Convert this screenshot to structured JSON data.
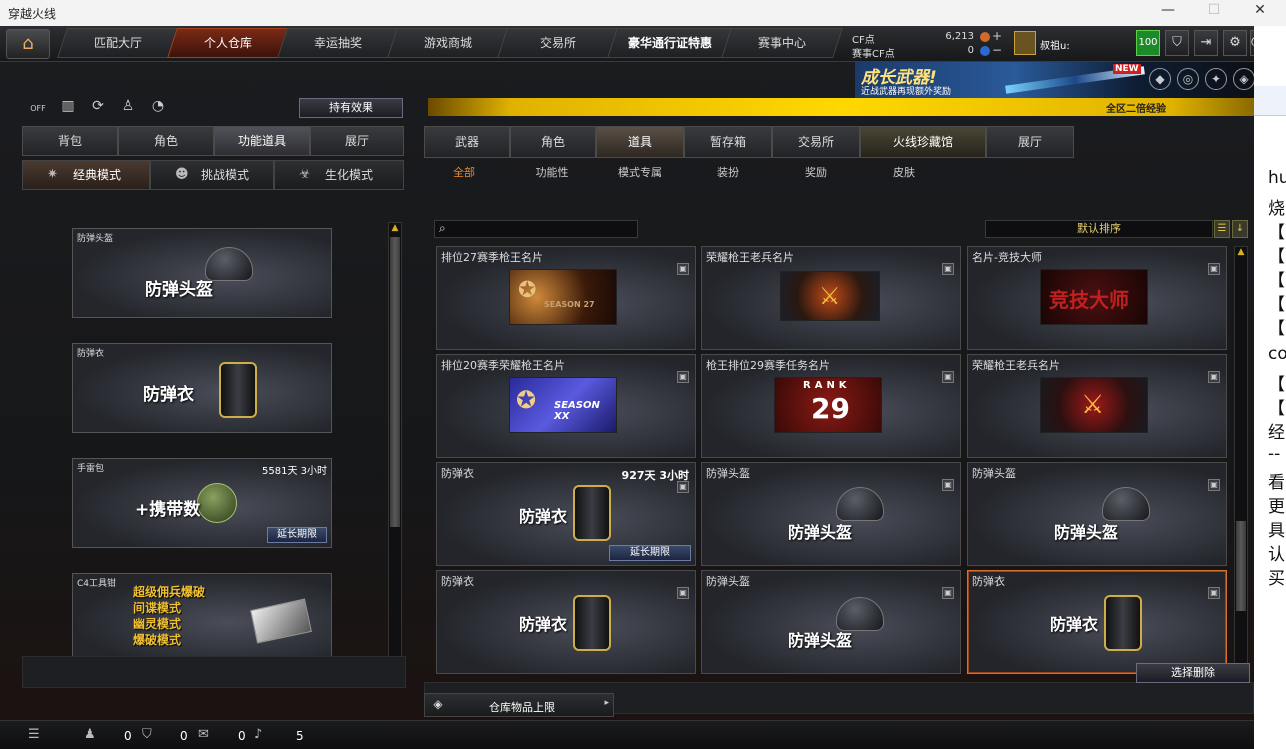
{
  "window": {
    "title": "穿越火线",
    "minimize": "—",
    "maximize": "☐",
    "close": "✕"
  },
  "nav": {
    "home_icon": "home-icon",
    "tabs": [
      "匹配大厅",
      "个人仓库",
      "幸运抽奖",
      "游戏商城",
      "交易所",
      "豪华通行证特惠",
      "赛事中心"
    ],
    "active": "个人仓库"
  },
  "currency": {
    "cf_label": "CF点",
    "cf_value": "6,213",
    "match_label": "赛事CF点",
    "match_value": "0",
    "plus": "+",
    "minus": "−"
  },
  "player": {
    "name": "叔祖u:",
    "level": "100"
  },
  "top_icons": {
    "shield": "⛉",
    "exit": "⇥",
    "settings": "⚙",
    "power": "⏻"
  },
  "banner": {
    "title": "成长武器!",
    "subtitle": "近战武器再现额外奖励",
    "badge": "NEW"
  },
  "gold_bar": {
    "text": "全区二倍经验"
  },
  "left": {
    "off_label": "OFF",
    "effect_button": "持有效果",
    "tabs": [
      "背包",
      "角色",
      "功能道具",
      "展厅"
    ],
    "active_tab": "功能道具",
    "modes": [
      "经典模式",
      "挑战模式",
      "生化模式"
    ],
    "active_mode": "经典模式",
    "items": [
      {
        "name": "防弹头盔",
        "big": "防弹头盔",
        "time": "",
        "extend": ""
      },
      {
        "name": "防弹衣",
        "big": "防弹衣",
        "time": "",
        "extend": ""
      },
      {
        "name": "手雷包",
        "big": "+携带数",
        "time": "5581天 3小时",
        "extend": "延长期限"
      },
      {
        "name": "C4工具钳",
        "big": "",
        "time": "",
        "extend": "",
        "modes": [
          "超级佣兵爆破",
          "间谍模式",
          "幽灵模式",
          "爆破模式"
        ]
      }
    ]
  },
  "right": {
    "tabs": [
      "武器",
      "角色",
      "道具",
      "暂存箱",
      "交易所",
      "火线珍藏馆",
      "展厅"
    ],
    "active_tab": "道具",
    "subtabs": [
      "全部",
      "功能性",
      "模式专属",
      "装扮",
      "奖励",
      "皮肤"
    ],
    "active_subtab": "全部",
    "search_placeholder": "",
    "sort_label": "默认排序",
    "cards": [
      {
        "name": "排位27赛季枪王名片",
        "plate": "SEASON 27"
      },
      {
        "name": "荣耀枪王老兵名片",
        "plate": ""
      },
      {
        "name": "名片-竞技大师",
        "plate": "竞技大师"
      },
      {
        "name": "排位20赛季荣耀枪王名片",
        "plate": "SEASON XX"
      },
      {
        "name": "枪王排位29赛季任务名片",
        "plate_top": "RANK",
        "plate": "29"
      },
      {
        "name": "荣耀枪王老兵名片",
        "plate": ""
      },
      {
        "name": "防弹衣",
        "big": "防弹衣",
        "time": "927天 3小时",
        "extend": "延长期限"
      },
      {
        "name": "防弹头盔",
        "big": "防弹头盔"
      },
      {
        "name": "防弹头盔",
        "big": "防弹头盔"
      },
      {
        "name": "防弹衣",
        "big": "防弹衣"
      },
      {
        "name": "防弹头盔",
        "big": "防弹头盔"
      },
      {
        "name": "防弹衣",
        "big": "防弹衣"
      }
    ],
    "delete_button": "选择删除",
    "capacity": "仓库物品上限"
  },
  "bottom": {
    "friends": "0",
    "shield": "0",
    "chat": "0",
    "volume": "5"
  },
  "side_text": [
    "hu",
    "烧",
    "【",
    "【",
    "【",
    "【",
    "【",
    "co",
    "【",
    "【",
    "经",
    "--",
    "看",
    "更",
    "具",
    "认",
    "买"
  ]
}
